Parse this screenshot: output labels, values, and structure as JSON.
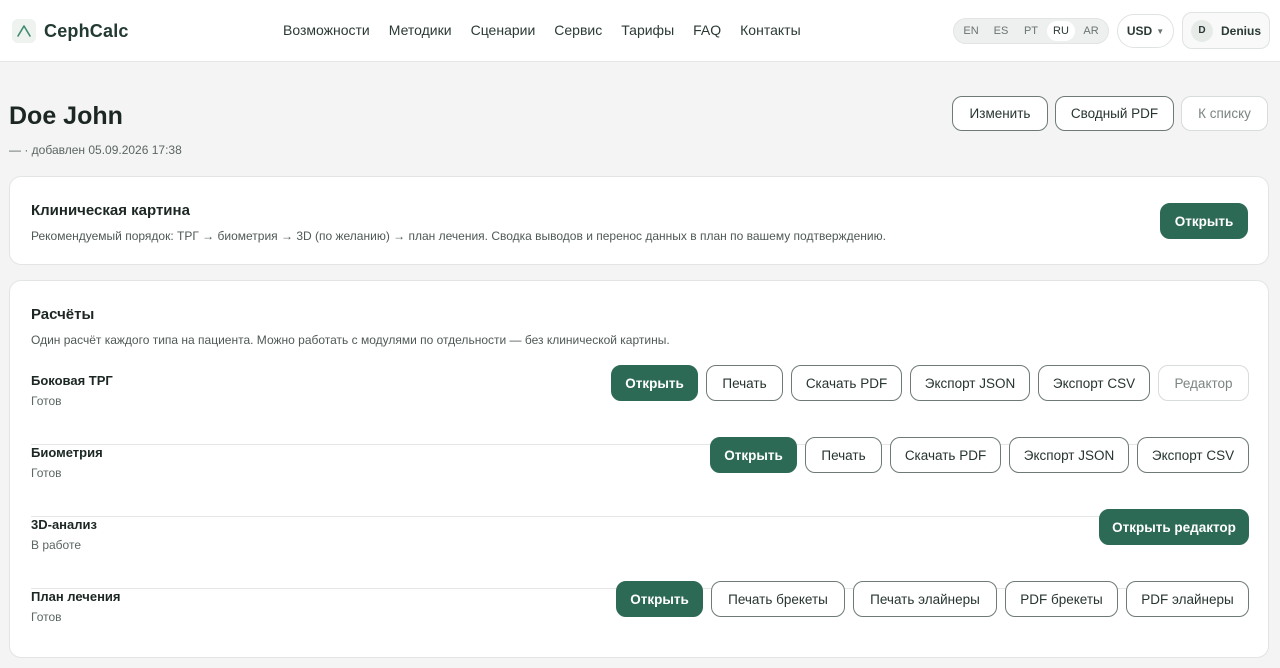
{
  "header": {
    "brand": "CephCalc",
    "nav": [
      "Возможности",
      "Методики",
      "Сценарии",
      "Сервис",
      "Тарифы",
      "FAQ",
      "Контакты"
    ],
    "languages": [
      "EN",
      "ES",
      "PT",
      "RU",
      "AR"
    ],
    "active_language": "RU",
    "currency": "USD",
    "user": {
      "initial": "D",
      "name": "Denius"
    }
  },
  "patient": {
    "name": "Doe John",
    "subtitle": "— · добавлен 05.09.2026 17:38",
    "actions": {
      "edit": "Изменить",
      "summary_pdf": "Сводный PDF",
      "to_list": "К списку"
    }
  },
  "clinical": {
    "title": "Клиническая картина",
    "description": "Рекомендуемый порядок: ТРГ → биометрия → 3D (по желанию) → план лечения. Сводка выводов и перенос данных в план по вашему подтверждению.",
    "open": "Открыть"
  },
  "calculations": {
    "title": "Расчёты",
    "description": "Один расчёт каждого типа на пациента. Можно работать с модулями по отдельности — без клинической картины.",
    "rows": [
      {
        "name": "Боковая ТРГ",
        "status": "Готов",
        "actions": [
          "Открыть",
          "Печать",
          "Скачать PDF",
          "Экспорт JSON",
          "Экспорт CSV",
          "Редактор"
        ]
      },
      {
        "name": "Биометрия",
        "status": "Готов",
        "actions": [
          "Открыть",
          "Печать",
          "Скачать PDF",
          "Экспорт JSON",
          "Экспорт CSV"
        ]
      },
      {
        "name": "3D-анализ",
        "status": "В работе",
        "actions": [
          "Открыть редактор"
        ]
      },
      {
        "name": "План лечения",
        "status": "Готов",
        "actions": [
          "Открыть",
          "Печать брекеты",
          "Печать элайнеры",
          "PDF брекеты",
          "PDF элайнеры"
        ]
      }
    ]
  },
  "colors": {
    "primary": "#2d6a55",
    "background": "#f3f4f3"
  }
}
